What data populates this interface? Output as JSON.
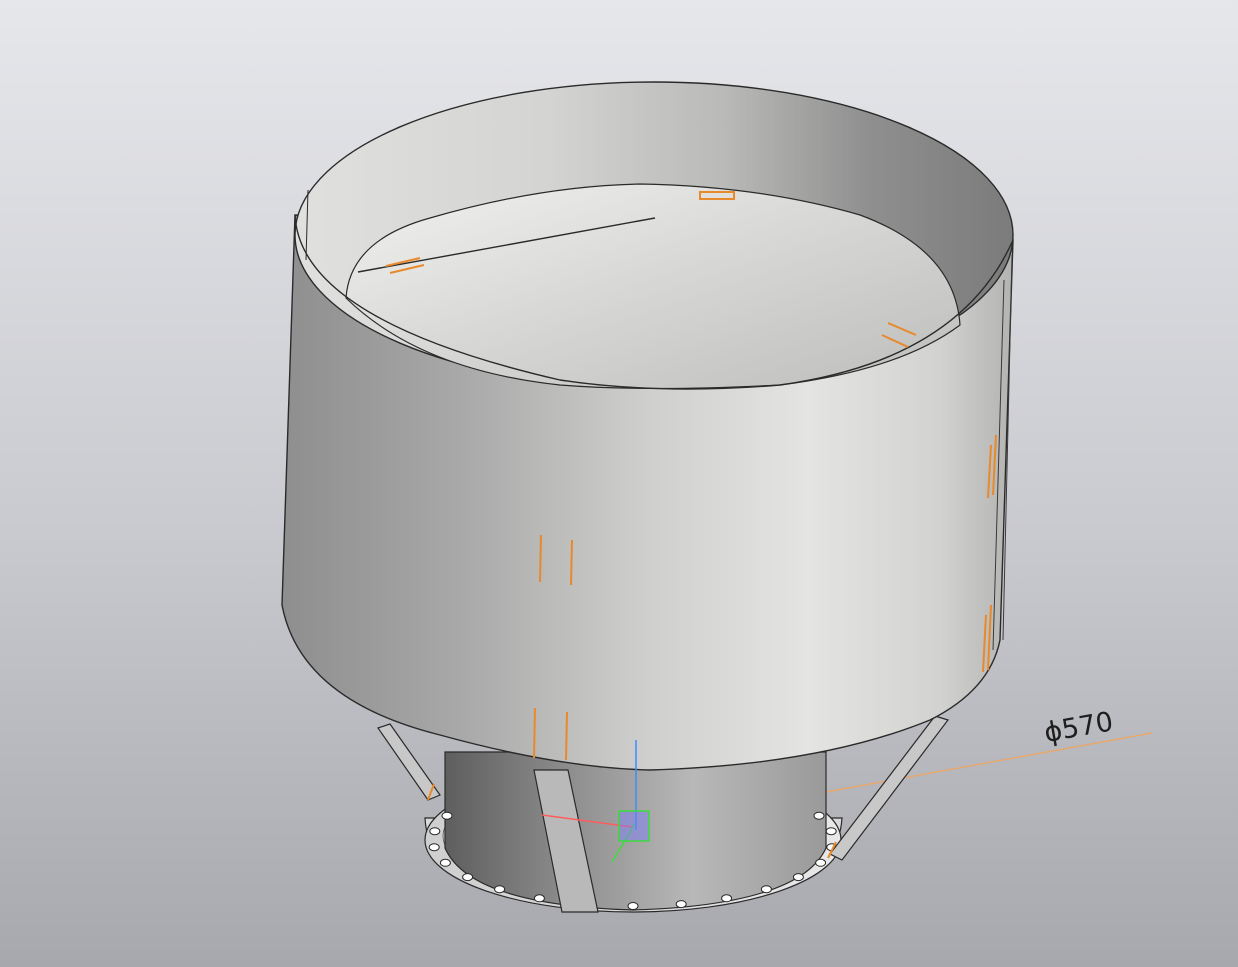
{
  "viewport": {
    "background_top": "#e6e7eb",
    "background_bottom": "#a7a8ae"
  },
  "model": {
    "kind": "cylindrical hood with conical cap on flanged pipe",
    "dimension_label": "ϕ570",
    "colors": {
      "edge": "#2a2a2a",
      "shell_light": "#e2e2e0",
      "shell_dark": "#7e7e7e",
      "weld_mark": "#e8892c",
      "dimension_line": "#e9a76a"
    }
  },
  "triad": {
    "x_axis_color": "#ff5c5c",
    "y_axis_color": "#3cdc3c",
    "z_axis_color": "#3c8cff"
  }
}
